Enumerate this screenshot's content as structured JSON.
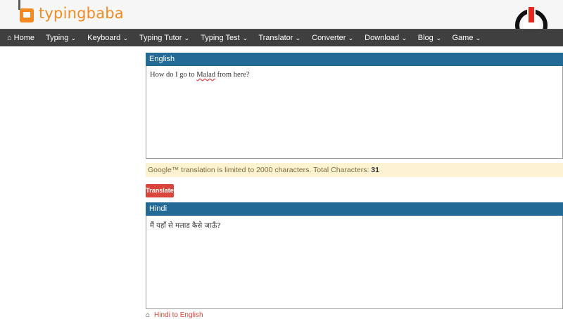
{
  "brand": {
    "name": "typingbaba",
    "accent": "#f28a1e"
  },
  "nav": {
    "home": "Home",
    "items": [
      {
        "label": "Typing"
      },
      {
        "label": "Keyboard"
      },
      {
        "label": "Typing Tutor"
      },
      {
        "label": "Typing Test"
      },
      {
        "label": "Translator"
      },
      {
        "label": "Converter"
      },
      {
        "label": "Download"
      },
      {
        "label": "Blog"
      },
      {
        "label": "Game"
      }
    ],
    "bg_color": "#3f3f3f"
  },
  "source": {
    "title": "English",
    "text_before": "How do I go to ",
    "misspelled": "Malad",
    "text_after": " from here?"
  },
  "notice": {
    "text": "Google™ translation is limited to 2000 characters. Total Characters: ",
    "count": "31"
  },
  "translate_button": {
    "label": "Translate",
    "color": "#d9453a"
  },
  "target": {
    "title": "Hindi",
    "text": "मैं यहाँ से मलाड कैसे जाऊँ?"
  },
  "bottom_link": {
    "label": "Hindi to English"
  },
  "panel_header_color": "#236b96"
}
